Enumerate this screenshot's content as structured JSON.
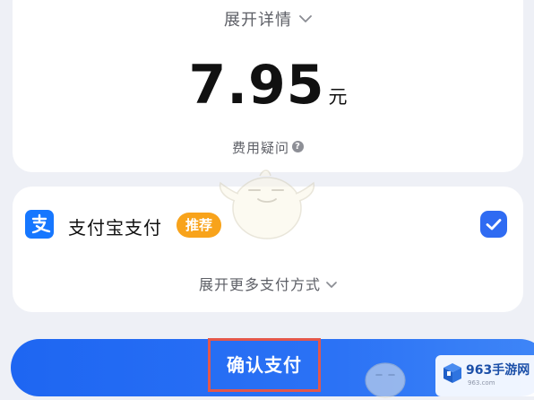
{
  "details": {
    "expand_label": "展开详情",
    "icon": "chevron-down-icon"
  },
  "amount": {
    "value": "7.95",
    "unit": "元"
  },
  "fee": {
    "question_label": "费用疑问",
    "icon": "question-circle-icon"
  },
  "payment": {
    "method_name": "支付宝支付",
    "badge": "推荐",
    "logo_icon": "alipay-icon",
    "selected": true,
    "more_methods_label": "展开更多支付方式"
  },
  "confirm": {
    "label": "确认支付"
  },
  "watermark": {
    "site_name": "963手游网",
    "site_url": "963.com"
  },
  "colors": {
    "primary_blue": "#2f6bf2",
    "badge_orange": "#f8a31b",
    "alipay_blue": "#1677ff",
    "highlight_red": "#e4574a"
  }
}
